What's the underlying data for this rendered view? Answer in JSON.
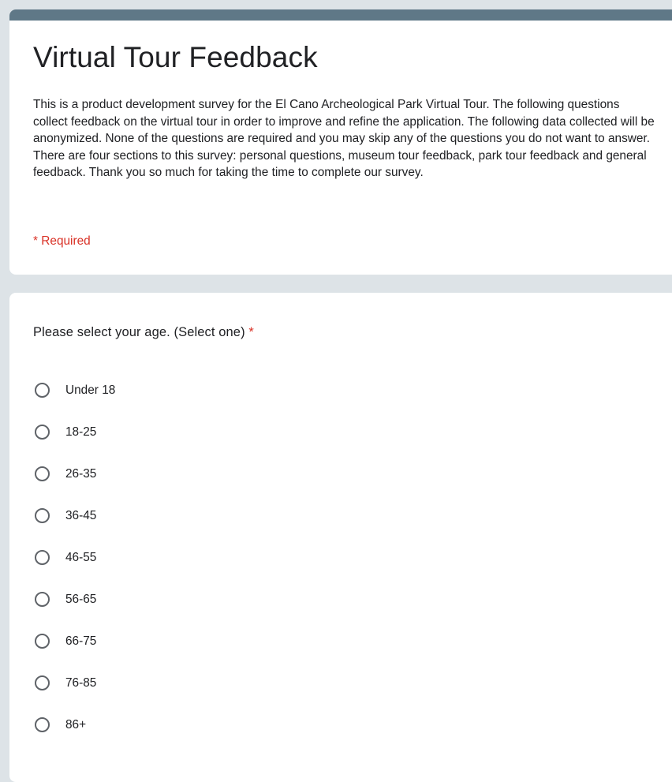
{
  "form": {
    "title": "Virtual Tour Feedback",
    "description": "This is a product development survey for the El Cano Archeological Park Virtual Tour. The following questions collect feedback on the virtual tour in order to improve and refine the application. The following data collected will be anonymized. None of the questions are required and you may skip any of the questions you do not want to answer. There are four sections to this survey: personal questions, museum tour feedback, park tour feedback and general feedback. Thank you so much for taking the time to complete our survey.",
    "required_note": "* Required",
    "header_color": "#5f7887"
  },
  "question": {
    "title": "Please select your age. (Select one)",
    "required_marker": "*",
    "options": [
      {
        "label": "Under 18",
        "selected": false
      },
      {
        "label": "18-25",
        "selected": false
      },
      {
        "label": "26-35",
        "selected": false
      },
      {
        "label": "36-45",
        "selected": false
      },
      {
        "label": "46-55",
        "selected": false
      },
      {
        "label": "56-65",
        "selected": false
      },
      {
        "label": "66-75",
        "selected": false
      },
      {
        "label": "76-85",
        "selected": false
      },
      {
        "label": "86+",
        "selected": false
      }
    ]
  }
}
